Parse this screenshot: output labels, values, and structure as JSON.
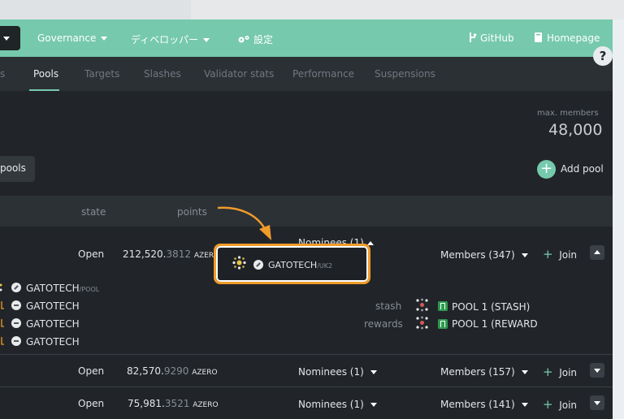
{
  "navbar": {
    "governance": "Governance",
    "developer": "ディベロッパー",
    "settings": "設定",
    "github": "GitHub",
    "homepage": "Homepage"
  },
  "tabs": [
    "s",
    "Pools",
    "Targets",
    "Slashes",
    "Validator stats",
    "Performance",
    "Suspensions"
  ],
  "help": "?",
  "summary": {
    "max_members_label": "max. members",
    "max_members_value": "48,000"
  },
  "pools_button": "pools",
  "add_pool": "Add pool",
  "table_header": {
    "state": "state",
    "points": "points"
  },
  "rows": [
    {
      "state": "Open",
      "points_int": "212,520.",
      "points_dec": "3812",
      "unit": "AZERO",
      "nominees": "Nominees (1)",
      "members": "Members (347)",
      "join": "Join",
      "highlight_name": "GATOTECH",
      "highlight_sub": "/UK2",
      "nominee_list": [
        {
          "name": "GATOTECH",
          "sub": "/POOL"
        },
        {
          "name": "GATOTECH",
          "sub": ""
        },
        {
          "name": "GATOTECH",
          "sub": ""
        },
        {
          "name": "GATOTECH",
          "sub": ""
        }
      ],
      "stash_label": "stash",
      "stash_value": "POOL 1 (STASH)",
      "rewards_label": "rewards",
      "rewards_value": "POOL 1 (REWARD"
    },
    {
      "state": "Open",
      "points_int": "82,570.",
      "points_dec": "9290",
      "unit": "AZERO",
      "nominees": "Nominees (1)",
      "members": "Members (157)",
      "join": "Join"
    },
    {
      "state": "Open",
      "points_int": "75,981.",
      "points_dec": "3521",
      "unit": "AZERO",
      "nominees": "Nominees (1)",
      "members": "Members (141)",
      "join": "Join"
    }
  ],
  "colors": {
    "accent": "#76c9ac",
    "highlight": "#f09b2a"
  }
}
